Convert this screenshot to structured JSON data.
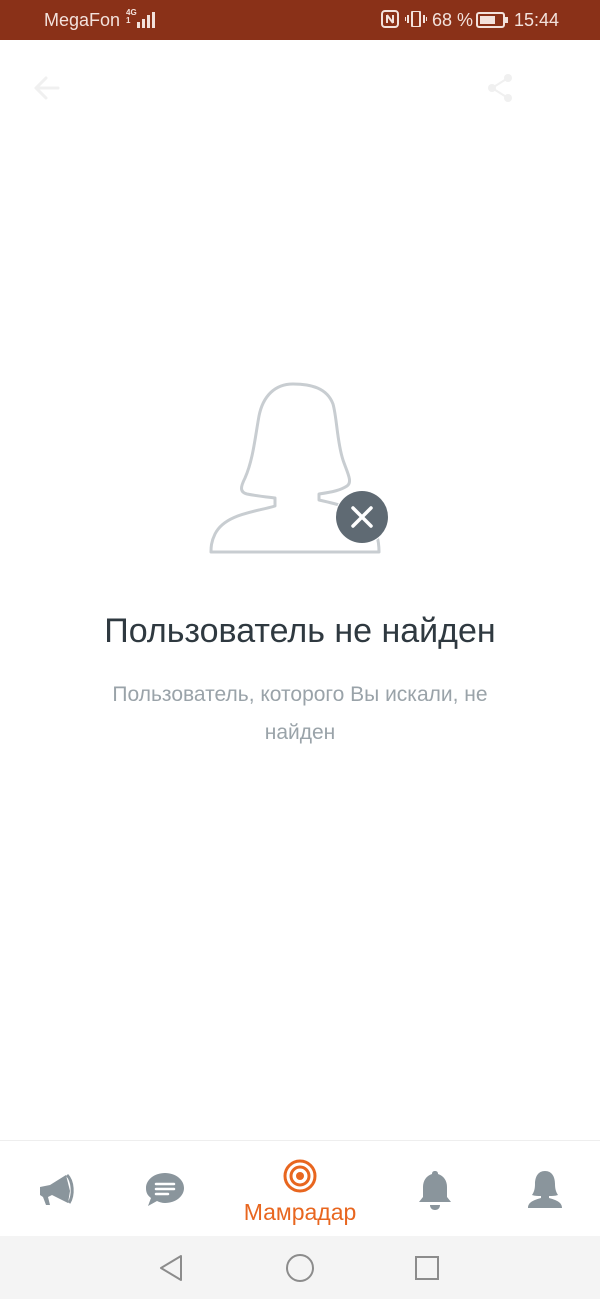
{
  "status_bar": {
    "carrier": "MegaFon",
    "network_top": "4G",
    "network_bottom": "1",
    "battery_percent": "68 %",
    "time": "15:44",
    "icons": [
      "signal-icon",
      "nfc-icon",
      "vibrate-icon",
      "battery-icon"
    ]
  },
  "top_bar": {
    "icons": [
      "back-arrow-icon",
      "share-icon"
    ]
  },
  "empty_state": {
    "icon": "user-not-found-icon",
    "title": "Пользователь не найден",
    "message": "Пользователь, которого Вы искали, не найден"
  },
  "bottom_nav": {
    "active_label": "Мамрадар",
    "active_color": "#e8661f",
    "inactive_color": "#8a959c",
    "icons": [
      "megaphone-icon",
      "chat-icon",
      "radar-icon",
      "bell-icon",
      "profile-icon"
    ]
  },
  "system_nav": {
    "icons": [
      "back-triangle-icon",
      "home-circle-icon",
      "recents-square-icon"
    ]
  }
}
